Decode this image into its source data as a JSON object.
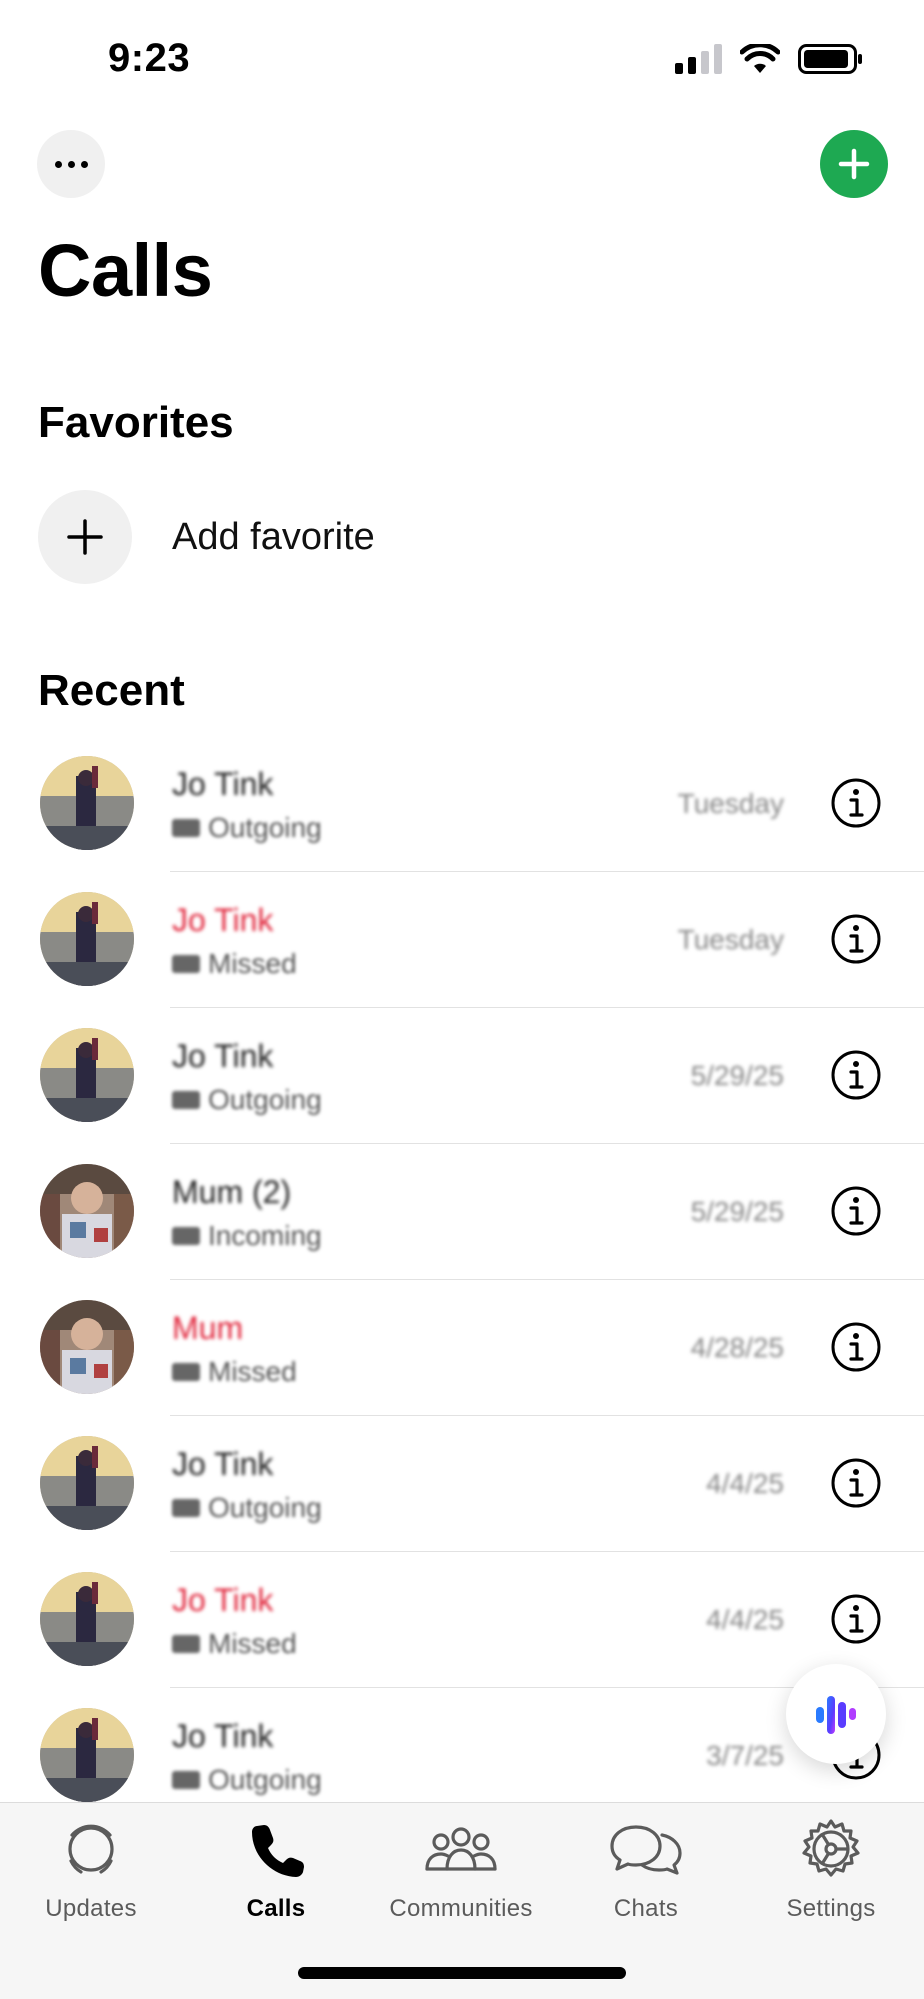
{
  "status_bar": {
    "time": "9:23"
  },
  "header": {
    "title": "Calls"
  },
  "favorites": {
    "title": "Favorites",
    "add_label": "Add favorite"
  },
  "recent": {
    "title": "Recent",
    "calls": [
      {
        "name": "Jo Tink",
        "type": "Outgoing",
        "date": "Tuesday",
        "missed": false,
        "avatar": "person-a"
      },
      {
        "name": "Jo Tink",
        "type": "Missed",
        "date": "Tuesday",
        "missed": true,
        "avatar": "person-a"
      },
      {
        "name": "Jo Tink",
        "type": "Outgoing",
        "date": "5/29/25",
        "missed": false,
        "avatar": "person-a"
      },
      {
        "name": "Mum (2)",
        "type": "Incoming",
        "date": "5/29/25",
        "missed": false,
        "avatar": "person-b"
      },
      {
        "name": "Mum",
        "type": "Missed",
        "date": "4/28/25",
        "missed": true,
        "avatar": "person-b"
      },
      {
        "name": "Jo Tink",
        "type": "Outgoing",
        "date": "4/4/25",
        "missed": false,
        "avatar": "person-a"
      },
      {
        "name": "Jo Tink",
        "type": "Missed",
        "date": "4/4/25",
        "missed": true,
        "avatar": "person-a"
      },
      {
        "name": "Jo Tink",
        "type": "Outgoing",
        "date": "3/7/25",
        "missed": false,
        "avatar": "person-a"
      }
    ]
  },
  "tabs": [
    {
      "label": "Updates",
      "icon": "updates-icon",
      "active": false
    },
    {
      "label": "Calls",
      "icon": "phone-icon",
      "active": true
    },
    {
      "label": "Communities",
      "icon": "communities-icon",
      "active": false
    },
    {
      "label": "Chats",
      "icon": "chats-icon",
      "active": false
    },
    {
      "label": "Settings",
      "icon": "settings-icon",
      "active": false
    }
  ],
  "colors": {
    "accent": "#1ea952",
    "missed": "#e0243a",
    "tab_bg": "#f6f6f6"
  }
}
